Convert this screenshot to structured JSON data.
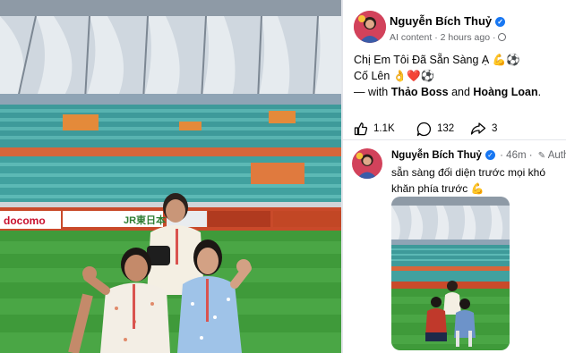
{
  "post": {
    "author": "Nguyễn Bích Thuỷ",
    "meta": "AI content · 2 hours ago ·",
    "line1": "Chị Em Tôi Đã Sẵn Sàng Ạ 💪⚽",
    "line2": "Cố Lên 👌❤️⚽",
    "with_prefix": "— with ",
    "tag1": "Thảo Boss",
    "and_word": " and ",
    "tag2": "Hoàng Loan",
    "period": "."
  },
  "actions": {
    "like_count": "1.1K",
    "comment_count": "132",
    "share_count": "3"
  },
  "comment": {
    "author": "Nguyễn Bích Thuỷ",
    "time": "· 46m ·",
    "badge": "Author",
    "text": "sẵn sàng đối diện trước mọi khó khăn phía trước 💪"
  },
  "photo": {
    "banner_sponsor": "docomo",
    "banner_jr": "JR東日本"
  },
  "colors": {
    "verified": "#1877f2",
    "secondary_text": "#65676b",
    "divider": "#e4e6eb"
  }
}
